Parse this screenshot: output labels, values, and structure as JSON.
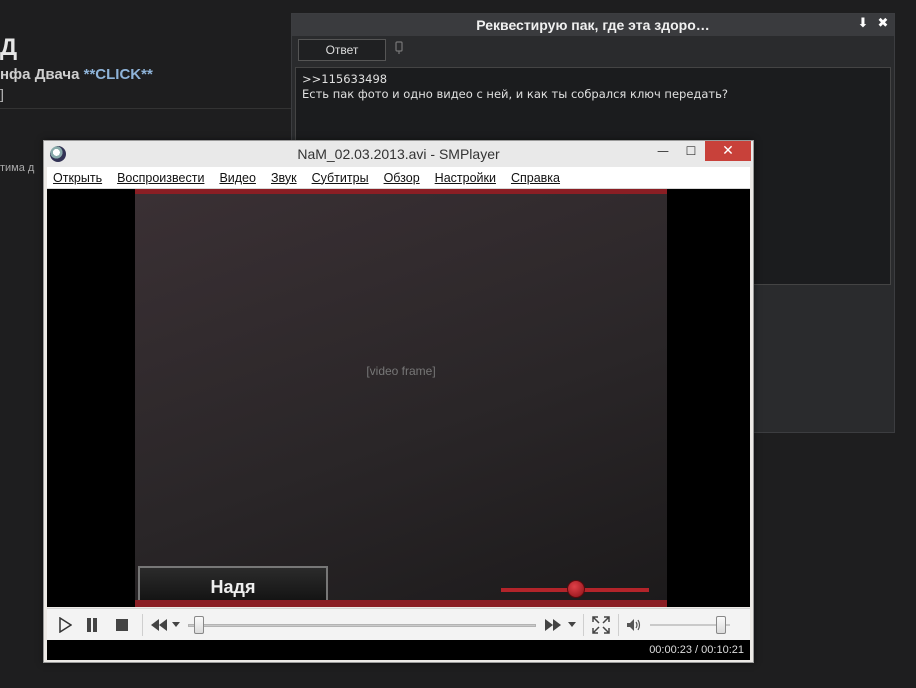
{
  "background_page": {
    "title": "Д",
    "subtitle_prefix": "нфа Двача",
    "subtitle_link": "**CLICK**",
    "bracket": "]",
    "snippet": "тима д"
  },
  "reply_dialog": {
    "title": "Реквестирую пак, где эта здоро…",
    "pin_icon": "⬇",
    "close_icon": "✖",
    "send_label": "Ответ",
    "text": ">>115633498\nЕсть пак фото и одно видео с ней, и как ты собрался ключ передать?"
  },
  "player": {
    "title": "NaM_02.03.2013.avi - SMPlayer",
    "minimize": "—",
    "maximize": "☐",
    "close": "✕",
    "menu": [
      "Открыть",
      "Воспроизвести",
      "Видео",
      "Звук",
      "Субтитры",
      "Обзор",
      "Настройки",
      "Справка"
    ],
    "overlay_name": "Надя",
    "video_placeholder": "[video frame]",
    "time": "00:00:23 / 00:10:21",
    "accent_color": "#8a1e24"
  }
}
